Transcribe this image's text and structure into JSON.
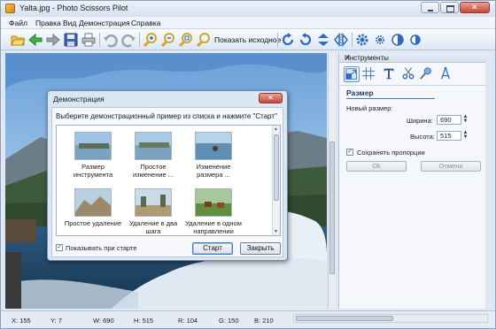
{
  "window": {
    "title": "Yalta.jpg - Photo Scissors Pilot",
    "icon": "app-scissors-icon"
  },
  "menu": [
    "Файл",
    "Правка",
    "Вид",
    "Демонстрация",
    "Справка"
  ],
  "toolbar": {
    "show_original_label": "Показать исходное",
    "icons": [
      "open-folder-icon",
      "back-arrow-icon",
      "forward-arrow-icon",
      "save-icon",
      "print-icon",
      "undo-icon",
      "redo-icon",
      "zoom-in-icon",
      "zoom-out-icon",
      "zoom-fit-icon",
      "zoom-actual-icon",
      "rotate-cw-icon",
      "rotate-ccw-icon",
      "flip-vertical-icon",
      "flip-horizontal-icon",
      "settings-gear-icon",
      "brightness-icon",
      "contrast-icon",
      "saturation-icon"
    ]
  },
  "panel": {
    "title": "Инструменты",
    "close": "✕",
    "tools": [
      "resize-tool-icon",
      "crop-grid-icon",
      "text-tool-icon",
      "scissors-tool-icon",
      "brush-tool-icon",
      "compass-tool-icon"
    ],
    "section": "Размер",
    "new_size_label": "Новый размер:",
    "width_label": "Ширина:",
    "width_value": "690",
    "height_label": "Высота:",
    "height_value": "515",
    "keep_ratio_label": "Сохранять пропорции",
    "keep_ratio_checked": true,
    "ok_label": "Ok",
    "cancel_label": "Отмена"
  },
  "status": {
    "x": "X: 155",
    "y": "Y: 7",
    "w": "W: 690",
    "h": "H: 515",
    "r": "R: 104",
    "g": "G: 150",
    "b": "B: 210"
  },
  "dialog": {
    "title": "Демонстрация",
    "close": "✕",
    "prompt": "Выберите демонстрационный пример из списка и нажмите \"Старт\"",
    "items": [
      {
        "line1": "Размер",
        "line2": "инструмента"
      },
      {
        "line1": "Простое",
        "line2": "изменение ..."
      },
      {
        "line1": "Изменение",
        "line2": "размера ..."
      },
      {
        "line1": "Простое удаление",
        "line2": ""
      },
      {
        "line1": "Удаление в два",
        "line2": "шага"
      },
      {
        "line1": "Удаление в одном",
        "line2": "направлении"
      }
    ],
    "show_on_start_label": "Показывать при старте",
    "show_on_start_checked": true,
    "start_label": "Старт",
    "close_label": "Закрыть"
  },
  "colors": {
    "accent": "#3b7cc4",
    "sky": "#3f7cc2",
    "sea": "#1f4f7a"
  }
}
